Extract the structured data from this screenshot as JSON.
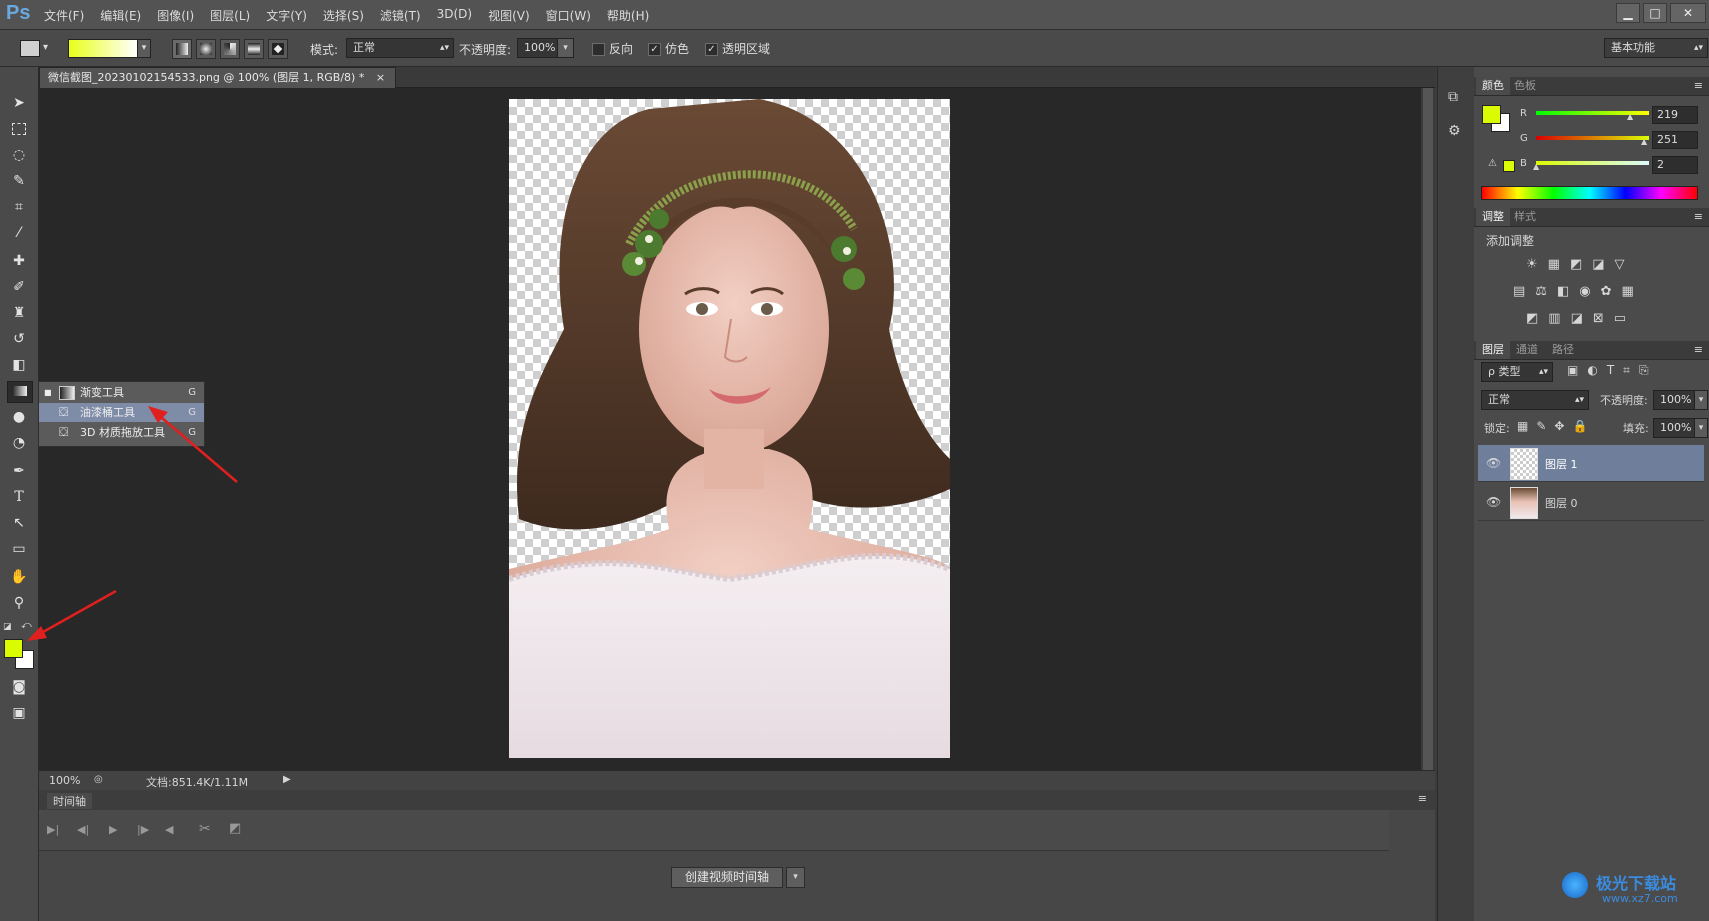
{
  "app": {
    "logo": "Ps"
  },
  "menu": [
    "文件(F)",
    "编辑(E)",
    "图像(I)",
    "图层(L)",
    "文字(Y)",
    "选择(S)",
    "滤镜(T)",
    "3D(D)",
    "视图(V)",
    "窗口(W)",
    "帮助(H)"
  ],
  "window_controls": {
    "minimize": "▁",
    "maximize": "□",
    "close": "✕"
  },
  "options": {
    "mode_label": "模式:",
    "mode_value": "正常",
    "opacity_label": "不透明度:",
    "opacity_value": "100%",
    "reverse_label": "反向",
    "dither_label": "仿色",
    "transparency_label": "透明区域",
    "reverse_checked": false,
    "dither_checked": true,
    "transparency_checked": true,
    "gradient_start": "#e8ff1a",
    "gradient_end": "#ffffff",
    "workspace": "基本功能"
  },
  "document": {
    "tab_title": "微信截图_20230102154533.png @ 100% (图层 1, RGB/8) *",
    "close_glyph": "×"
  },
  "flyout": {
    "items": [
      {
        "label": "渐变工具",
        "key": "G"
      },
      {
        "label": "油漆桶工具",
        "key": "G"
      },
      {
        "label": "3D 材质拖放工具",
        "key": "G"
      }
    ]
  },
  "status": {
    "zoom": "100%",
    "doc_info": "文档:851.4K/1.11M"
  },
  "timeline": {
    "title": "时间轴",
    "create_button": "创建视频时间轴"
  },
  "color_panel": {
    "tabs": [
      "颜色",
      "色板"
    ],
    "r_label": "R",
    "g_label": "G",
    "b_label": "B",
    "r": "219",
    "g": "251",
    "b": "2",
    "foreground": "#dbfb02",
    "background": "#ffffff"
  },
  "adjust_panel": {
    "tabs": [
      "调整",
      "样式"
    ],
    "heading": "添加调整"
  },
  "layers_panel": {
    "tabs": [
      "图层",
      "通道",
      "路径"
    ],
    "filter_label": "ρ 类型",
    "blend_mode": "正常",
    "opacity_label": "不透明度:",
    "opacity_value": "100%",
    "lock_label": "锁定:",
    "fill_label": "填充:",
    "fill_value": "100%",
    "layers": [
      {
        "name": "图层 1",
        "selected": true
      },
      {
        "name": "图层 0",
        "selected": false
      }
    ]
  },
  "watermark": {
    "title": "极光下载站",
    "url": "www.xz7.com"
  },
  "colors": {
    "accent": "#dbfb02",
    "annotation_arrow": "#e0201e",
    "selection_blue": "#6f7f9b"
  }
}
